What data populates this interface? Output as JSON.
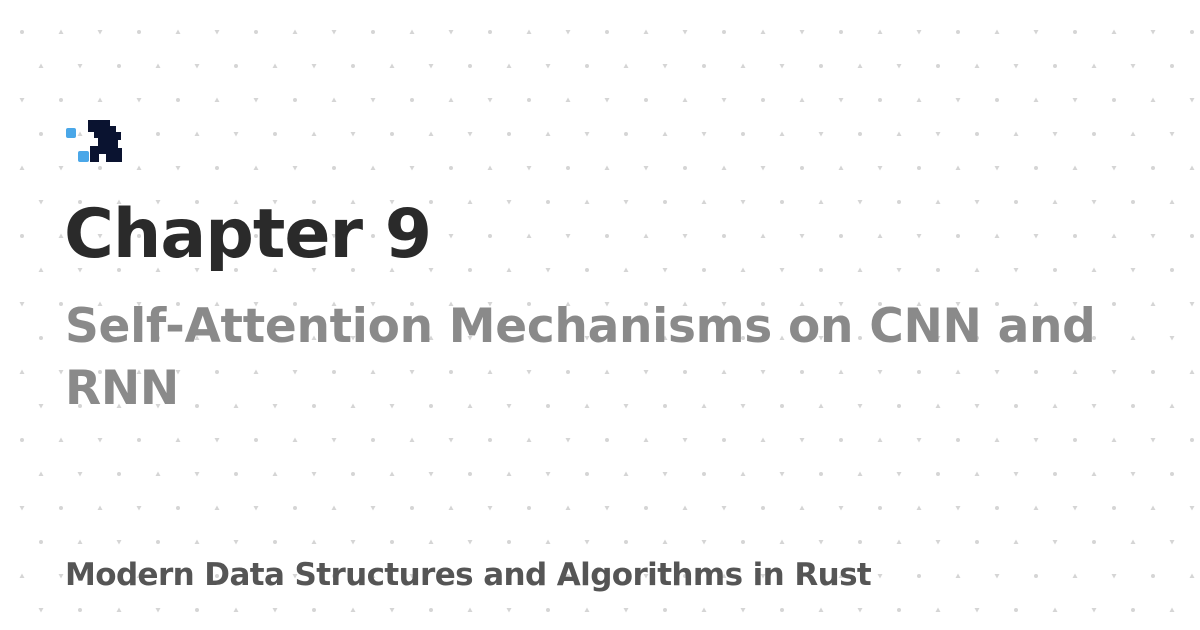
{
  "card": {
    "chapter": "Chapter 9",
    "subtitle": "Self-Attention Mechanisms on CNN and RNN",
    "book_title": "Modern Data Structures and Algorithms in Rust"
  },
  "logo": {
    "icon": "head-profile-icon",
    "colors": {
      "head": "#0a1330",
      "squares": "#4aa7e8"
    }
  },
  "colors": {
    "background": "#ffffff",
    "pattern_dot": "#d5d5d5",
    "title": "#2a2a2a",
    "subtitle": "#8a8a8a",
    "book_title": "#555555"
  }
}
